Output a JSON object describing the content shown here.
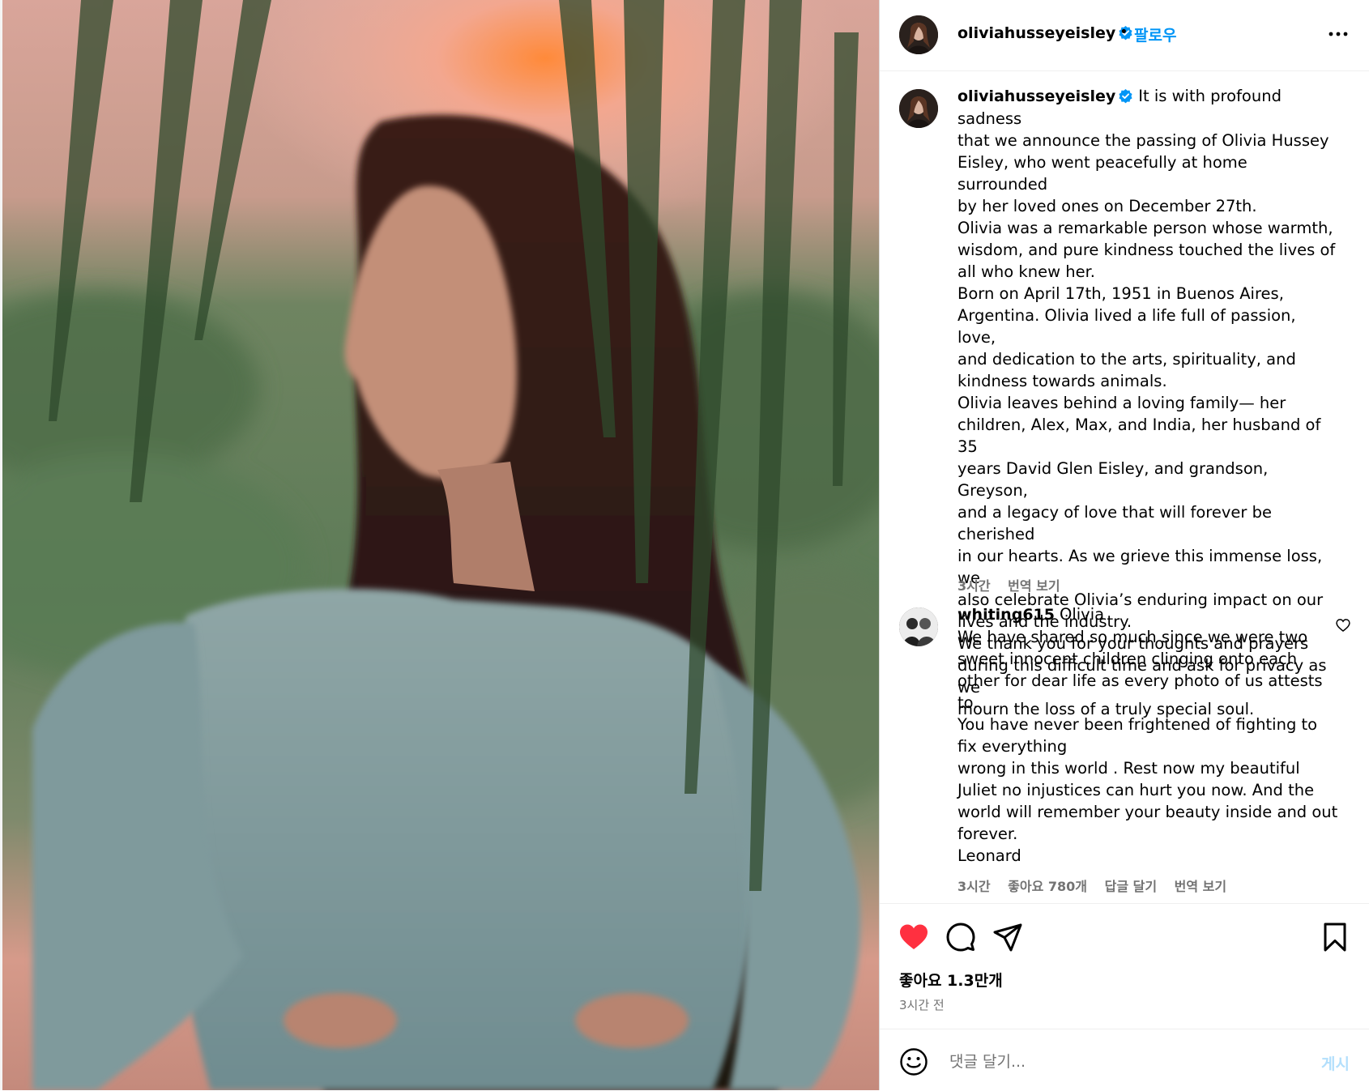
{
  "post": {
    "author": "oliviahusseyeisley",
    "verified": true,
    "separator": "•",
    "follow_label": "팔로우",
    "photo_description_icon": "portrait-photo"
  },
  "caption": {
    "author": "oliviahusseyeisley",
    "lines": [
      "It is with profound sadness",
      "that we announce the passing of Olivia Hussey",
      "Eisley, who went peacefully at home surrounded",
      "by her loved ones on December 27th.",
      "Olivia was a remarkable person whose warmth,",
      "wisdom, and pure kindness touched the lives of",
      "all who knew her.",
      "Born on April 17th, 1951 in Buenos Aires,",
      "Argentina. Olivia lived a life full of passion, love,",
      "and dedication to the arts, spirituality, and",
      "kindness towards animals.",
      "Olivia leaves behind a loving family— her",
      "children, Alex, Max, and India, her husband of 35",
      "years David Glen Eisley, and grandson, Greyson,",
      "and a legacy of love that will forever be cherished",
      "in our hearts. As we grieve this immense loss, we",
      "also celebrate Olivia’s enduring impact on our",
      "lives and the industry.",
      "We thank you for your thoughts and prayers",
      "during this difficult time and ask for privacy as we",
      "mourn the loss of a truly special soul."
    ],
    "time": "3시간",
    "translate": "번역 보기"
  },
  "comment": {
    "author": "whiting615",
    "first_line": "Olivia",
    "lines": [
      "We have shared so much since we were two",
      "sweet innocent children clinging onto each",
      "other for dear life as every photo of us attests",
      "to.",
      "You have never been frightened of fighting to",
      "fix everything",
      "wrong in this world . Rest now my beautiful",
      "Juliet no injustices can hurt you now. And the",
      "world will remember your beauty inside and out",
      "forever.",
      "Leonard"
    ],
    "time": "3시간",
    "likes": "좋아요 780개",
    "reply": "답글 달기",
    "translate": "번역 보기"
  },
  "actions": {
    "likes_text": "좋아요 1.3만개",
    "time_ago": "3시간 전",
    "liked": true,
    "like_color": "#ff3040"
  },
  "comment_bar": {
    "placeholder": "댓글 달기...",
    "post_label": "게시"
  },
  "colors": {
    "follow": "#0095f6",
    "post_disabled": "#b2dffc",
    "secondary_text": "#737373"
  }
}
